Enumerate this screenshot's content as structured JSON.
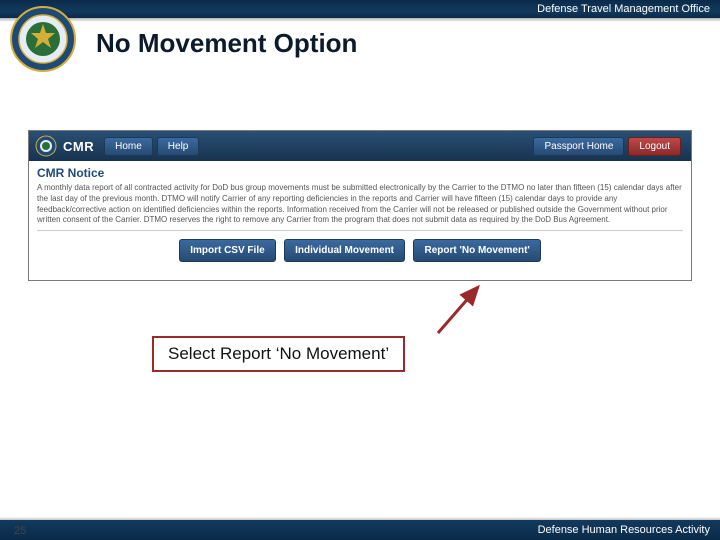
{
  "header": {
    "org": "Defense Travel Management Office"
  },
  "title": "No Movement Option",
  "app": {
    "brand": "CMR",
    "nav": {
      "home": "Home",
      "help": "Help",
      "passport": "Passport Home",
      "logout": "Logout"
    },
    "notice_title": "CMR Notice",
    "notice_body": "A monthly data report of all contracted activity for DoD bus group movements must be submitted electronically by the Carrier to the DTMO no later than fifteen (15) calendar days after the last day of the previous month. DTMO will notify Carrier of any reporting deficiencies in the reports and Carrier will have fifteen (15) calendar days to provide any feedback/corrective action on identified deficiencies within the reports. Information received from the Carrier will not be released or published outside the Government without prior written consent of the Carrier. DTMO reserves the right to remove any Carrier from the program that does not submit data as required by the DoD Bus Agreement.",
    "actions": {
      "import": "Import CSV File",
      "individual": "Individual Movement",
      "report": "Report 'No Movement'"
    }
  },
  "callout": "Select Report ‘No Movement’",
  "footer": {
    "org": "Defense Human Resources Activity"
  },
  "page_number": "25"
}
